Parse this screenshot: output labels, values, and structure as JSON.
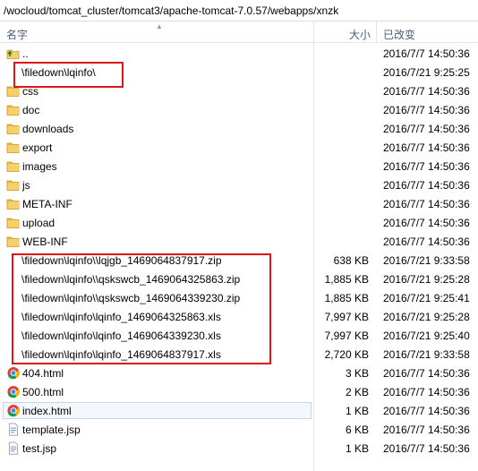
{
  "path": "/wocloud/tomcat_cluster/tomcat3/apache-tomcat-7.0.57/webapps/xnzk",
  "columns": {
    "name": "名字",
    "size": "大小",
    "modified": "已改变"
  },
  "rows": [
    {
      "name": "..",
      "type": "up",
      "size": "",
      "modified": "2016/7/7 14:50:36"
    },
    {
      "name": "\\filedown\\lqinfo\\",
      "type": "blank",
      "size": "",
      "modified": "2016/7/21 9:25:25"
    },
    {
      "name": "css",
      "type": "folder",
      "size": "",
      "modified": "2016/7/7 14:50:36"
    },
    {
      "name": "doc",
      "type": "folder",
      "size": "",
      "modified": "2016/7/7 14:50:36"
    },
    {
      "name": "downloads",
      "type": "folder",
      "size": "",
      "modified": "2016/7/7 14:50:36"
    },
    {
      "name": "export",
      "type": "folder",
      "size": "",
      "modified": "2016/7/7 14:50:36"
    },
    {
      "name": "images",
      "type": "folder",
      "size": "",
      "modified": "2016/7/7 14:50:36"
    },
    {
      "name": "js",
      "type": "folder",
      "size": "",
      "modified": "2016/7/7 14:50:36"
    },
    {
      "name": "META-INF",
      "type": "folder",
      "size": "",
      "modified": "2016/7/7 14:50:36"
    },
    {
      "name": "upload",
      "type": "folder",
      "size": "",
      "modified": "2016/7/7 14:50:36"
    },
    {
      "name": "WEB-INF",
      "type": "folder",
      "size": "",
      "modified": "2016/7/7 14:50:36"
    },
    {
      "name": "\\filedown\\lqinfo\\\\lqjgb_1469064837917.zip",
      "type": "blank",
      "size": "638 KB",
      "modified": "2016/7/21 9:33:58"
    },
    {
      "name": "\\filedown\\lqinfo\\\\qskswcb_1469064325863.zip",
      "type": "blank",
      "size": "1,885 KB",
      "modified": "2016/7/21 9:25:28"
    },
    {
      "name": "\\filedown\\lqinfo\\\\qskswcb_1469064339230.zip",
      "type": "blank",
      "size": "1,885 KB",
      "modified": "2016/7/21 9:25:41"
    },
    {
      "name": "\\filedown\\lqinfo\\lqinfo_1469064325863.xls",
      "type": "blank",
      "size": "7,997 KB",
      "modified": "2016/7/21 9:25:28"
    },
    {
      "name": "\\filedown\\lqinfo\\lqinfo_1469064339230.xls",
      "type": "blank",
      "size": "7,997 KB",
      "modified": "2016/7/21 9:25:40"
    },
    {
      "name": "\\filedown\\lqinfo\\lqinfo_1469064837917.xls",
      "type": "blank",
      "size": "2,720 KB",
      "modified": "2016/7/21 9:33:58"
    },
    {
      "name": "404.html",
      "type": "chrome",
      "size": "3 KB",
      "modified": "2016/7/7 14:50:36"
    },
    {
      "name": "500.html",
      "type": "chrome",
      "size": "2 KB",
      "modified": "2016/7/7 14:50:36"
    },
    {
      "name": "index.html",
      "type": "chrome",
      "size": "1 KB",
      "modified": "2016/7/7 14:50:36",
      "selected": true
    },
    {
      "name": "template.jsp",
      "type": "jsp",
      "size": "6 KB",
      "modified": "2016/7/7 14:50:36"
    },
    {
      "name": "test.jsp",
      "type": "jsp",
      "size": "1 KB",
      "modified": "2016/7/7 14:50:36"
    }
  ],
  "colors": {
    "highlight": "#e0141b",
    "header_text": "#4c607a",
    "folder": "#e8b53e"
  }
}
